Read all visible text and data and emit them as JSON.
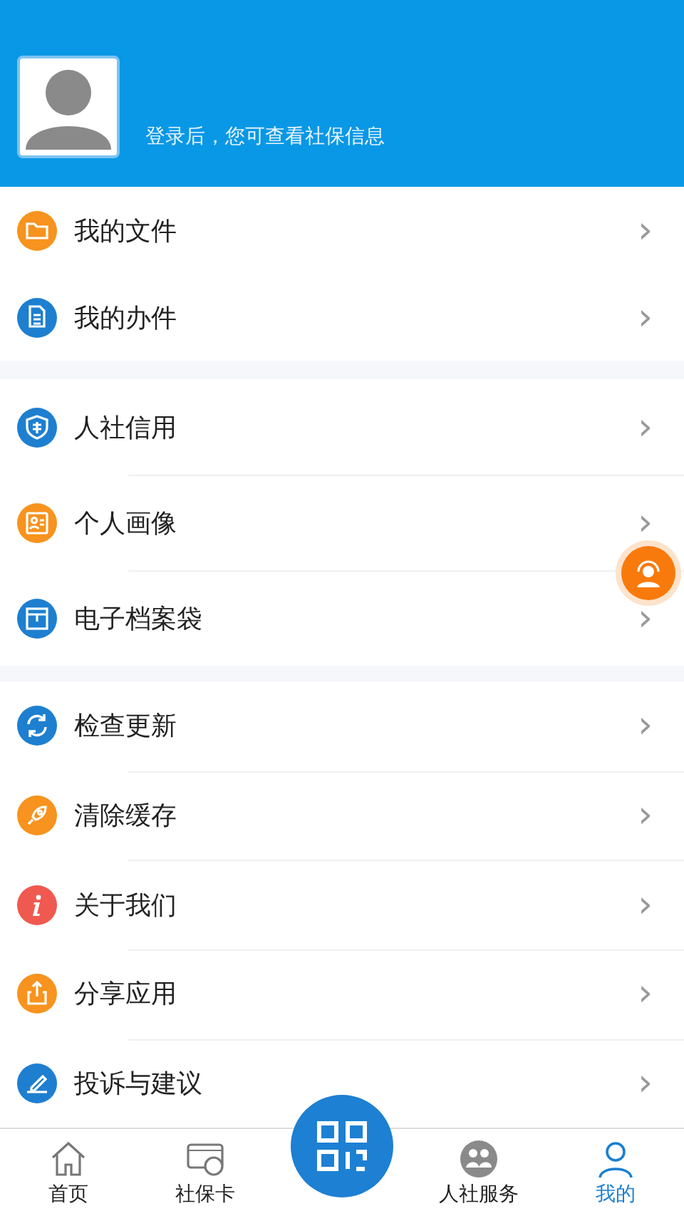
{
  "header": {
    "login_hint": "登录后，您可查看社保信息"
  },
  "menu_groups": [
    {
      "items": [
        {
          "kind": "folder",
          "color": "#f7931e",
          "label": "我的文件",
          "chevron": "›"
        },
        {
          "kind": "document",
          "color": "#1e7fd0",
          "label": "我的办件",
          "chevron": "›"
        }
      ]
    },
    {
      "items": [
        {
          "kind": "shield",
          "color": "#1e7fd0",
          "label": "人社信用",
          "chevron": "›"
        },
        {
          "kind": "portrait",
          "color": "#f7931e",
          "label": "个人画像",
          "chevron": "›"
        },
        {
          "kind": "archive",
          "color": "#1e7fd0",
          "label": "电子档案袋",
          "chevron": "›"
        }
      ]
    },
    {
      "items": [
        {
          "kind": "refresh",
          "color": "#1e7fd0",
          "label": "检查更新",
          "chevron": "›"
        },
        {
          "kind": "rocket",
          "color": "#f7931e",
          "label": "清除缓存",
          "chevron": "›"
        },
        {
          "kind": "info",
          "color": "#f0594f",
          "label": "关于我们",
          "chevron": "›"
        },
        {
          "kind": "share",
          "color": "#f7931e",
          "label": "分享应用",
          "chevron": "›"
        },
        {
          "kind": "feedback",
          "color": "#1e7fd0",
          "label": "投诉与建议",
          "chevron": "›"
        }
      ]
    }
  ],
  "bottom_nav": [
    {
      "kind": "home",
      "label": "首页",
      "selected": false
    },
    {
      "kind": "card",
      "label": "社保卡",
      "selected": false
    },
    {
      "kind": "qr"
    },
    {
      "kind": "people",
      "label": "人社服务",
      "selected": false
    },
    {
      "kind": "person",
      "label": "我的",
      "selected": true
    }
  ]
}
